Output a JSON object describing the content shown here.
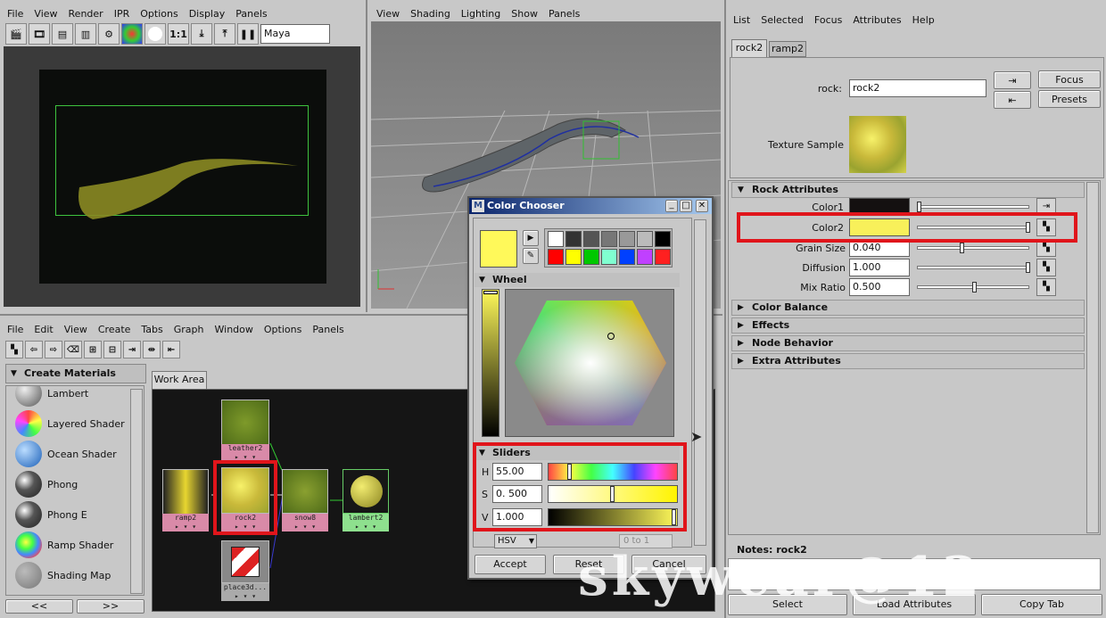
{
  "render_view": {
    "menu": [
      "File",
      "View",
      "Render",
      "IPR",
      "Options",
      "Display",
      "Panels"
    ],
    "renderer_select": "Maya Software",
    "ratio_label": "1:1"
  },
  "persp_view": {
    "menu": [
      "View",
      "Shading",
      "Lighting",
      "Show",
      "Panels"
    ]
  },
  "hypershade": {
    "menu": [
      "File",
      "Edit",
      "View",
      "Create",
      "Tabs",
      "Graph",
      "Window",
      "Options",
      "Panels"
    ],
    "create_header": "Create Materials",
    "materials": [
      "Lambert",
      "Layered Shader",
      "Ocean Shader",
      "Phong",
      "Phong E",
      "Ramp Shader",
      "Shading Map"
    ],
    "scroll_left": "<<",
    "scroll_right": ">>",
    "work_area_tab": "Work Area",
    "nodes": [
      "leather2",
      "rock2",
      "snow8",
      "lambert2",
      "ramp2",
      "place3d..."
    ]
  },
  "color_chooser": {
    "title": "Color Chooser",
    "wheel_header": "Wheel",
    "sliders_header": "Sliders",
    "h_label": "H",
    "h_value": "55.00",
    "s_label": "S",
    "s_value": "0. 500",
    "v_label": "V",
    "v_value": "1.000",
    "mode": "HSV",
    "range": "0 to 1",
    "accept": "Accept",
    "reset": "Reset",
    "cancel": "Cancel",
    "current_color": "#fff95a",
    "swatches_row1": [
      "#ffffff",
      "#333333",
      "#555555",
      "#777777",
      "#999999",
      "#bbbbbb",
      "#000000"
    ],
    "swatches_row2": [
      "#ff0000",
      "#ffff00",
      "#00c800",
      "#80ffd0",
      "#0040ff",
      "#c040ff",
      "#ff2020"
    ]
  },
  "attr_editor": {
    "menu": [
      "List",
      "Selected",
      "Focus",
      "Attributes",
      "Help"
    ],
    "tabs": [
      "rock2",
      "ramp2"
    ],
    "node_label": "rock:",
    "node_value": "rock2",
    "focus": "Focus",
    "presets": "Presets",
    "texture_sample_label": "Texture Sample",
    "rock_section": "Rock Attributes",
    "color1_label": "Color1",
    "color1": "#141010",
    "color2_label": "Color2",
    "color2": "#f8f05a",
    "grain_label": "Grain Size",
    "grain_value": "0.040",
    "diffusion_label": "Diffusion",
    "diffusion_value": "1.000",
    "mix_label": "Mix Ratio",
    "mix_value": "0.500",
    "sections": [
      "Color Balance",
      "Effects",
      "Node Behavior",
      "Extra Attributes"
    ],
    "notes": "Notes: rock2",
    "select": "Select",
    "load": "Load Attributes",
    "copy": "Copy Tab"
  },
  "watermark": "skywear@12"
}
